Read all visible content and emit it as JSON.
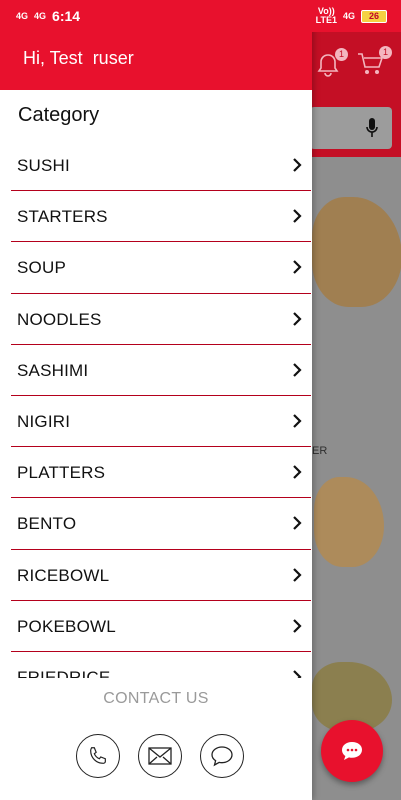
{
  "status_bar": {
    "time": "6:14",
    "net_left_1": "4G",
    "net_left_2": "4G",
    "net_right_1": "Vo))\nLTE1",
    "net_right_2": "4G",
    "battery": "26"
  },
  "drawer": {
    "greeting": "Hi, Test  ruser",
    "category_title": "Category",
    "categories": [
      "SUSHI",
      "STARTERS",
      "SOUP",
      "NOODLES",
      "SASHIMI",
      "NIGIRI",
      "PLATTERS",
      "BENTO",
      "RICEBOWL",
      "POKEBOWL",
      "FRIEDRICE"
    ],
    "contact_label": "CONTACT US"
  },
  "background": {
    "notification_count": "1",
    "cart_count": "1",
    "partial_label": "ER"
  },
  "colors": {
    "brand_red": "#e8112d",
    "divider": "#b4001c"
  },
  "icons": [
    "bell-icon",
    "cart-icon",
    "mic-icon",
    "chevron-right-icon",
    "phone-icon",
    "mail-icon",
    "chat-icon"
  ]
}
